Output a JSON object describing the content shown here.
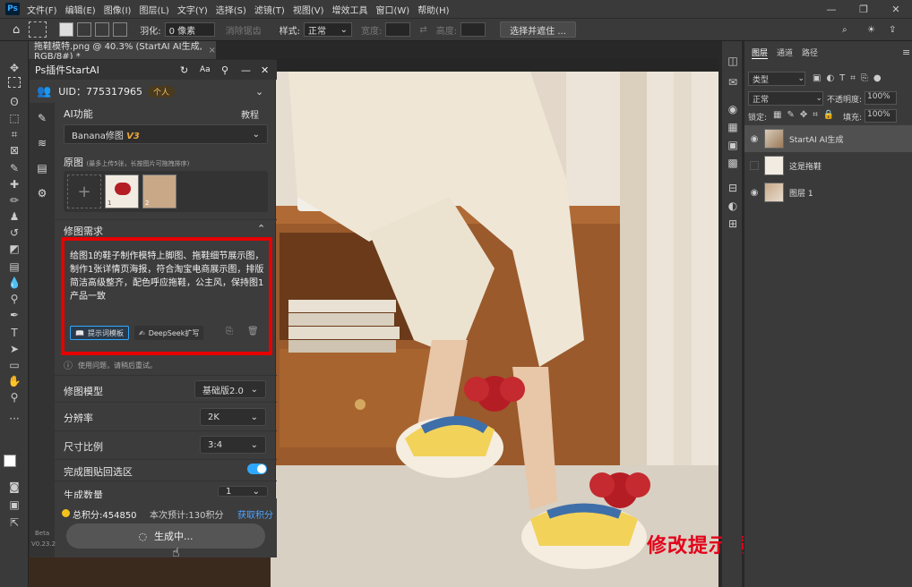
{
  "menubar": {
    "app_icon": "Ps",
    "items": [
      "文件(F)",
      "编辑(E)",
      "图像(I)",
      "图层(L)",
      "文字(Y)",
      "选择(S)",
      "滤镜(T)",
      "视图(V)",
      "增效工具",
      "窗口(W)",
      "帮助(H)"
    ]
  },
  "options": {
    "feather_label": "羽化:",
    "feather_value": "0 像素",
    "antialias": "消除锯齿",
    "style_label": "样式:",
    "style_value": "正常",
    "width_label": "宽度:",
    "height_label": "高度:",
    "select_subject": "选择并遮住 ..."
  },
  "document": {
    "tab_title": "拖鞋模特.png @ 40.3% (StartAI AI生成, RGB/8#) *"
  },
  "plugin": {
    "title": "Ps插件StartAI",
    "uid_label": "UID：775317965",
    "account_type": "个人",
    "ai_function_label": "AI功能",
    "tutorial_label": "教程",
    "model_name": "Banana修图",
    "model_version": "V3",
    "source_label": "原图",
    "source_hint": "(最多上传5张，长按图片可拖拽排序)",
    "thumb_1": "1",
    "thumb_2": "2",
    "requirement_label": "修图需求",
    "prompt": "给图1的鞋子制作模特上脚图、拖鞋细节展示图，制作1张详情页海报，符合淘宝电商展示图，排版简洁高级整齐，配色呼应拖鞋，公主风，保持图1产品一致",
    "template_btn": "提示词模板",
    "deepseek_btn": "DeepSeek扩写",
    "notice": "使用问题，请稍后重试。",
    "model_label": "修图模型",
    "model_value": "基础版2.0",
    "resolution_label": "分辨率",
    "resolution_value": "2K",
    "ratio_label": "尺寸比例",
    "ratio_value": "3:4",
    "paste_label": "完成图贴回选区",
    "count_label": "生成数量",
    "count_value": "1",
    "points_total": "总积分:454850",
    "points_estimate": "本次预计:130积分",
    "get_points": "获取积分",
    "generate_btn": "生成中...",
    "beta_label": "Beta",
    "version_label": "V0.23.2"
  },
  "layers_panel": {
    "tabs": [
      "图层",
      "通道",
      "路径"
    ],
    "filter_label": "类型",
    "blend_mode": "正常",
    "opacity_label": "不透明度:",
    "opacity_value": "100%",
    "lock_label": "锁定:",
    "fill_label": "填充:",
    "fill_value": "100%",
    "layers": [
      {
        "name": "StartAI AI生成",
        "visible": true
      },
      {
        "name": "这是拖鞋",
        "visible": false
      },
      {
        "name": "图层 1",
        "visible": true
      }
    ]
  },
  "overlay_caption": "修改提示词制作详情页",
  "colors": {
    "accent": "#31a8ff",
    "highlight_border": "#e60000",
    "caption": "#e3001a",
    "points": "#4fa3ff"
  }
}
